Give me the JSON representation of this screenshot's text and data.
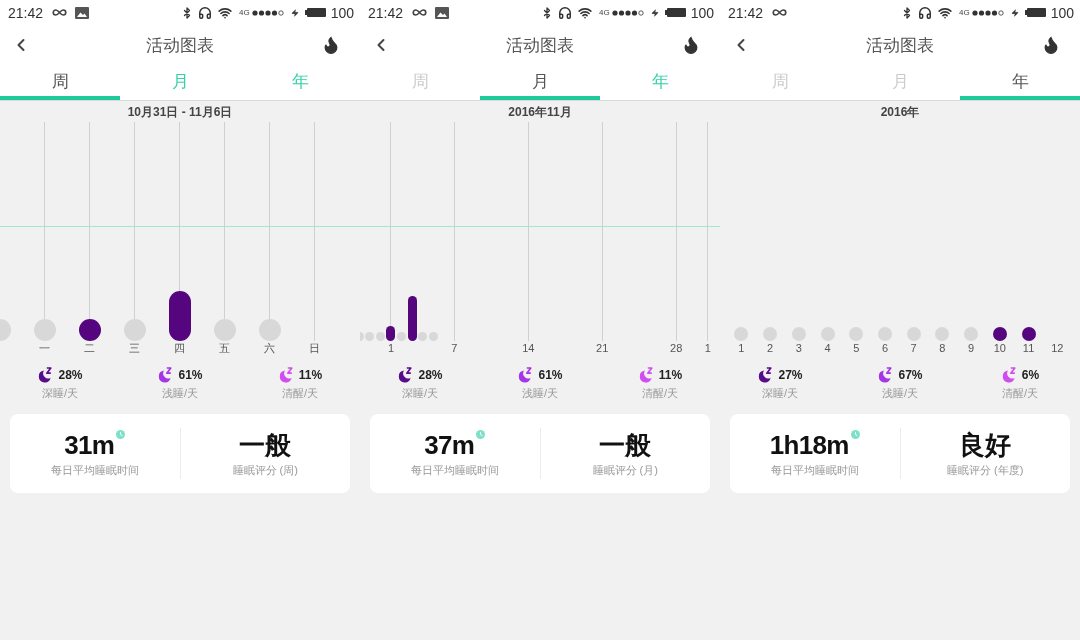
{
  "panels": [
    {
      "status_bar": {
        "time": "21:42",
        "notifications": [
          {
            "kind": "infinity"
          },
          {
            "kind": "image"
          }
        ],
        "network": "4G",
        "battery": "100"
      },
      "header": {
        "title": "活动图表"
      },
      "tabs": [
        {
          "label": "周",
          "selected": true,
          "color": "#555555"
        },
        {
          "label": "月",
          "selected": false,
          "color": "#33d1a4"
        },
        {
          "label": "年",
          "selected": false,
          "color": "#33d1a4"
        }
      ],
      "chart": {
        "period": "10月31日 - 11月6日",
        "kind": "week",
        "goal_line": true,
        "columns": [
          {
            "kind": "empty"
          },
          {
            "label": "一",
            "kind": "empty"
          },
          {
            "label": "二",
            "kind": "dot"
          },
          {
            "label": "三",
            "kind": "empty"
          },
          {
            "label": "四",
            "kind": "bar_tall"
          },
          {
            "label": "五",
            "kind": "empty"
          },
          {
            "label": "六",
            "kind": "empty"
          },
          {
            "label": "日",
            "kind": "none"
          }
        ]
      },
      "stats": [
        {
          "value": "28%",
          "label": "深睡/天",
          "color": "#5a0b8c"
        },
        {
          "value": "61%",
          "label": "浅睡/天",
          "color": "#a834e8"
        },
        {
          "value": "11%",
          "label": "清醒/天",
          "color": "#d24cf0"
        }
      ],
      "summary": {
        "duration": "31m",
        "duration_label": "每日平均睡眠时间",
        "rating": "一般",
        "rating_label": "睡眠评分 (周)"
      }
    },
    {
      "status_bar": {
        "time": "21:42",
        "notifications": [
          {
            "kind": "infinity"
          },
          {
            "kind": "image"
          }
        ],
        "network": "4G",
        "battery": "100"
      },
      "header": {
        "title": "活动图表"
      },
      "tabs": [
        {
          "label": "周",
          "selected": false,
          "color": "#cccccc"
        },
        {
          "label": "月",
          "selected": true,
          "color": "#555555"
        },
        {
          "label": "年",
          "selected": false,
          "color": "#33d1a4"
        }
      ],
      "chart": {
        "period": "2016年11月",
        "kind": "month",
        "goal_line": true,
        "columns": [
          {
            "kind": "empty"
          },
          {
            "kind": "empty"
          },
          {
            "kind": "empty"
          },
          {
            "label": "1",
            "kind": "bar_short"
          },
          {
            "kind": "empty"
          },
          {
            "kind": "bar_tall"
          },
          {
            "kind": "empty"
          },
          {
            "kind": "empty"
          },
          {
            "kind": "none"
          },
          {
            "label": "7",
            "kind": "none"
          },
          {
            "kind": "none"
          },
          {
            "kind": "none"
          },
          {
            "kind": "none"
          },
          {
            "kind": "none"
          },
          {
            "kind": "none"
          },
          {
            "kind": "none"
          },
          {
            "label": "14",
            "kind": "none"
          },
          {
            "kind": "none"
          },
          {
            "kind": "none"
          },
          {
            "kind": "none"
          },
          {
            "kind": "none"
          },
          {
            "kind": "none"
          },
          {
            "kind": "none"
          },
          {
            "label": "21",
            "kind": "none"
          },
          {
            "kind": "none"
          },
          {
            "kind": "none"
          },
          {
            "kind": "none"
          },
          {
            "kind": "none"
          },
          {
            "kind": "none"
          },
          {
            "kind": "none"
          },
          {
            "label": "28",
            "kind": "none"
          },
          {
            "kind": "none"
          },
          {
            "kind": "none"
          },
          {
            "label": "1",
            "kind": "none"
          }
        ]
      },
      "stats": [
        {
          "value": "28%",
          "label": "深睡/天",
          "color": "#5a0b8c"
        },
        {
          "value": "61%",
          "label": "浅睡/天",
          "color": "#a834e8"
        },
        {
          "value": "11%",
          "label": "清醒/天",
          "color": "#d24cf0"
        }
      ],
      "summary": {
        "duration": "37m",
        "duration_label": "每日平均睡眠时间",
        "rating": "一般",
        "rating_label": "睡眠评分 (月)"
      }
    },
    {
      "status_bar": {
        "time": "21:42",
        "notifications": [
          {
            "kind": "infinity"
          }
        ],
        "network": "4G",
        "battery": "100"
      },
      "header": {
        "title": "活动图表"
      },
      "tabs": [
        {
          "label": "周",
          "selected": false,
          "color": "#cccccc"
        },
        {
          "label": "月",
          "selected": false,
          "color": "#cccccc"
        },
        {
          "label": "年",
          "selected": true,
          "color": "#555555"
        }
      ],
      "chart": {
        "period": "2016年",
        "kind": "year",
        "columns": [
          {
            "label": "1",
            "kind": "empty"
          },
          {
            "label": "2",
            "kind": "empty"
          },
          {
            "label": "3",
            "kind": "empty"
          },
          {
            "label": "4",
            "kind": "empty"
          },
          {
            "label": "5",
            "kind": "empty"
          },
          {
            "label": "6",
            "kind": "empty"
          },
          {
            "label": "7",
            "kind": "empty"
          },
          {
            "label": "8",
            "kind": "empty"
          },
          {
            "label": "9",
            "kind": "empty"
          },
          {
            "label": "10",
            "kind": "dot"
          },
          {
            "label": "11",
            "kind": "dot"
          },
          {
            "label": "12",
            "kind": "none"
          }
        ]
      },
      "stats": [
        {
          "value": "27%",
          "label": "深睡/天",
          "color": "#5a0b8c"
        },
        {
          "value": "67%",
          "label": "浅睡/天",
          "color": "#a834e8"
        },
        {
          "value": "6%",
          "label": "清醒/天",
          "color": "#d24cf0"
        }
      ],
      "summary": {
        "duration": "1h18m",
        "duration_label": "每日平均睡眠时间",
        "rating": "良好",
        "rating_label": "睡眠评分 (年度)"
      }
    }
  ]
}
